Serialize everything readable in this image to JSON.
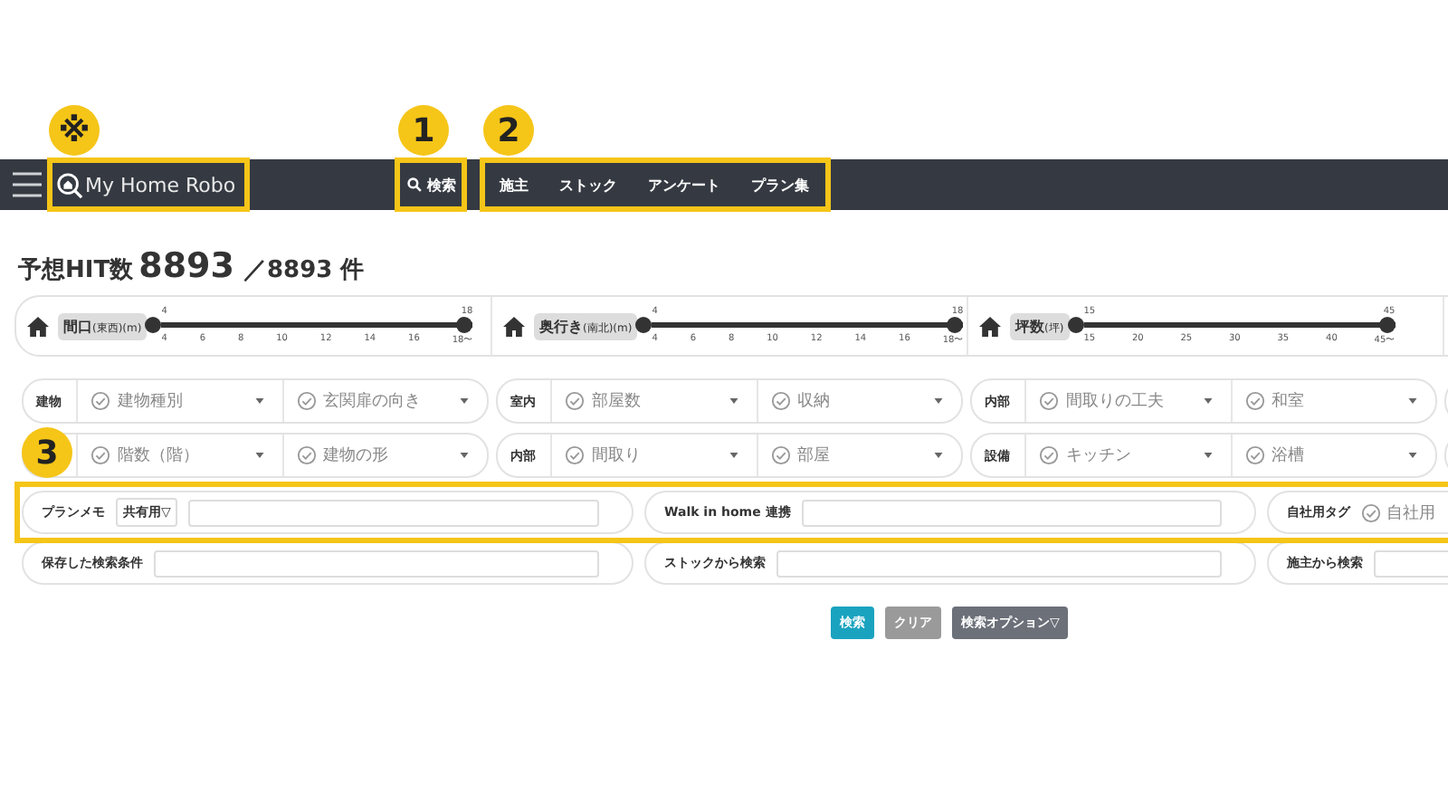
{
  "annotations": [
    {
      "label": "※",
      "kind": "logo"
    },
    {
      "label": "1",
      "kind": "search"
    },
    {
      "label": "2",
      "kind": "nav"
    },
    {
      "label": "3",
      "kind": "row"
    }
  ],
  "navbar": {
    "logo": "My Home Robo",
    "search_button": "検索",
    "items": [
      {
        "label": "施主"
      },
      {
        "label": "ストック"
      },
      {
        "label": "アンケート"
      },
      {
        "label": "プラン集"
      }
    ]
  },
  "hit": {
    "label": "予想HIT数",
    "count": "8893",
    "total": "／8893 件"
  },
  "sliders": [
    {
      "label": "間口",
      "unit": "(東西)(m)",
      "min": "4",
      "max": "18",
      "level": 1,
      "ticks": [
        "4",
        "6",
        "8",
        "10",
        "12",
        "14",
        "16",
        "18〜"
      ]
    },
    {
      "label": "奥行き",
      "unit": "(南北)(m)",
      "min": "4",
      "max": "18",
      "level": 1,
      "ticks": [
        "4",
        "6",
        "8",
        "10",
        "12",
        "14",
        "16",
        "18〜"
      ]
    },
    {
      "label": "坪数",
      "unit": "(坪)",
      "min": "15",
      "max": "45",
      "level": 1,
      "ticks": [
        "15",
        "20",
        "25",
        "30",
        "35",
        "40",
        "45〜"
      ]
    }
  ],
  "filter_rows": [
    [
      {
        "label": "建物",
        "selects": [
          "建物種別",
          "玄関扉の向き"
        ]
      },
      {
        "label": "室内",
        "selects": [
          "部屋数",
          "収納"
        ]
      },
      {
        "label": "内部",
        "selects": [
          "間取りの工夫",
          "和室"
        ]
      }
    ],
    [
      {
        "selects": [
          "階数（階）",
          "建物の形"
        ]
      },
      {
        "label": "内部",
        "selects": [
          "間取り",
          "部屋"
        ]
      },
      {
        "label": "設備",
        "selects": [
          "キッチン",
          "浴槽"
        ]
      }
    ]
  ],
  "text_rows": [
    [
      {
        "label": "プランメモ",
        "dropdown": "共有用▽",
        "kind": "input"
      },
      {
        "label": "Walk in home 連携",
        "kind": "input"
      },
      {
        "label": "自社用タグ",
        "select": "自社用",
        "kind": "select"
      }
    ],
    [
      {
        "label": "保存した検索条件",
        "kind": "input"
      },
      {
        "label": "ストックから検索",
        "kind": "input"
      },
      {
        "label": "施主から検索",
        "kind": "input"
      }
    ]
  ],
  "buttons": [
    {
      "label": "検索",
      "kind": "primary"
    },
    {
      "label": "クリア",
      "kind": "clear"
    },
    {
      "label": "検索オプション▽",
      "kind": "option"
    }
  ]
}
